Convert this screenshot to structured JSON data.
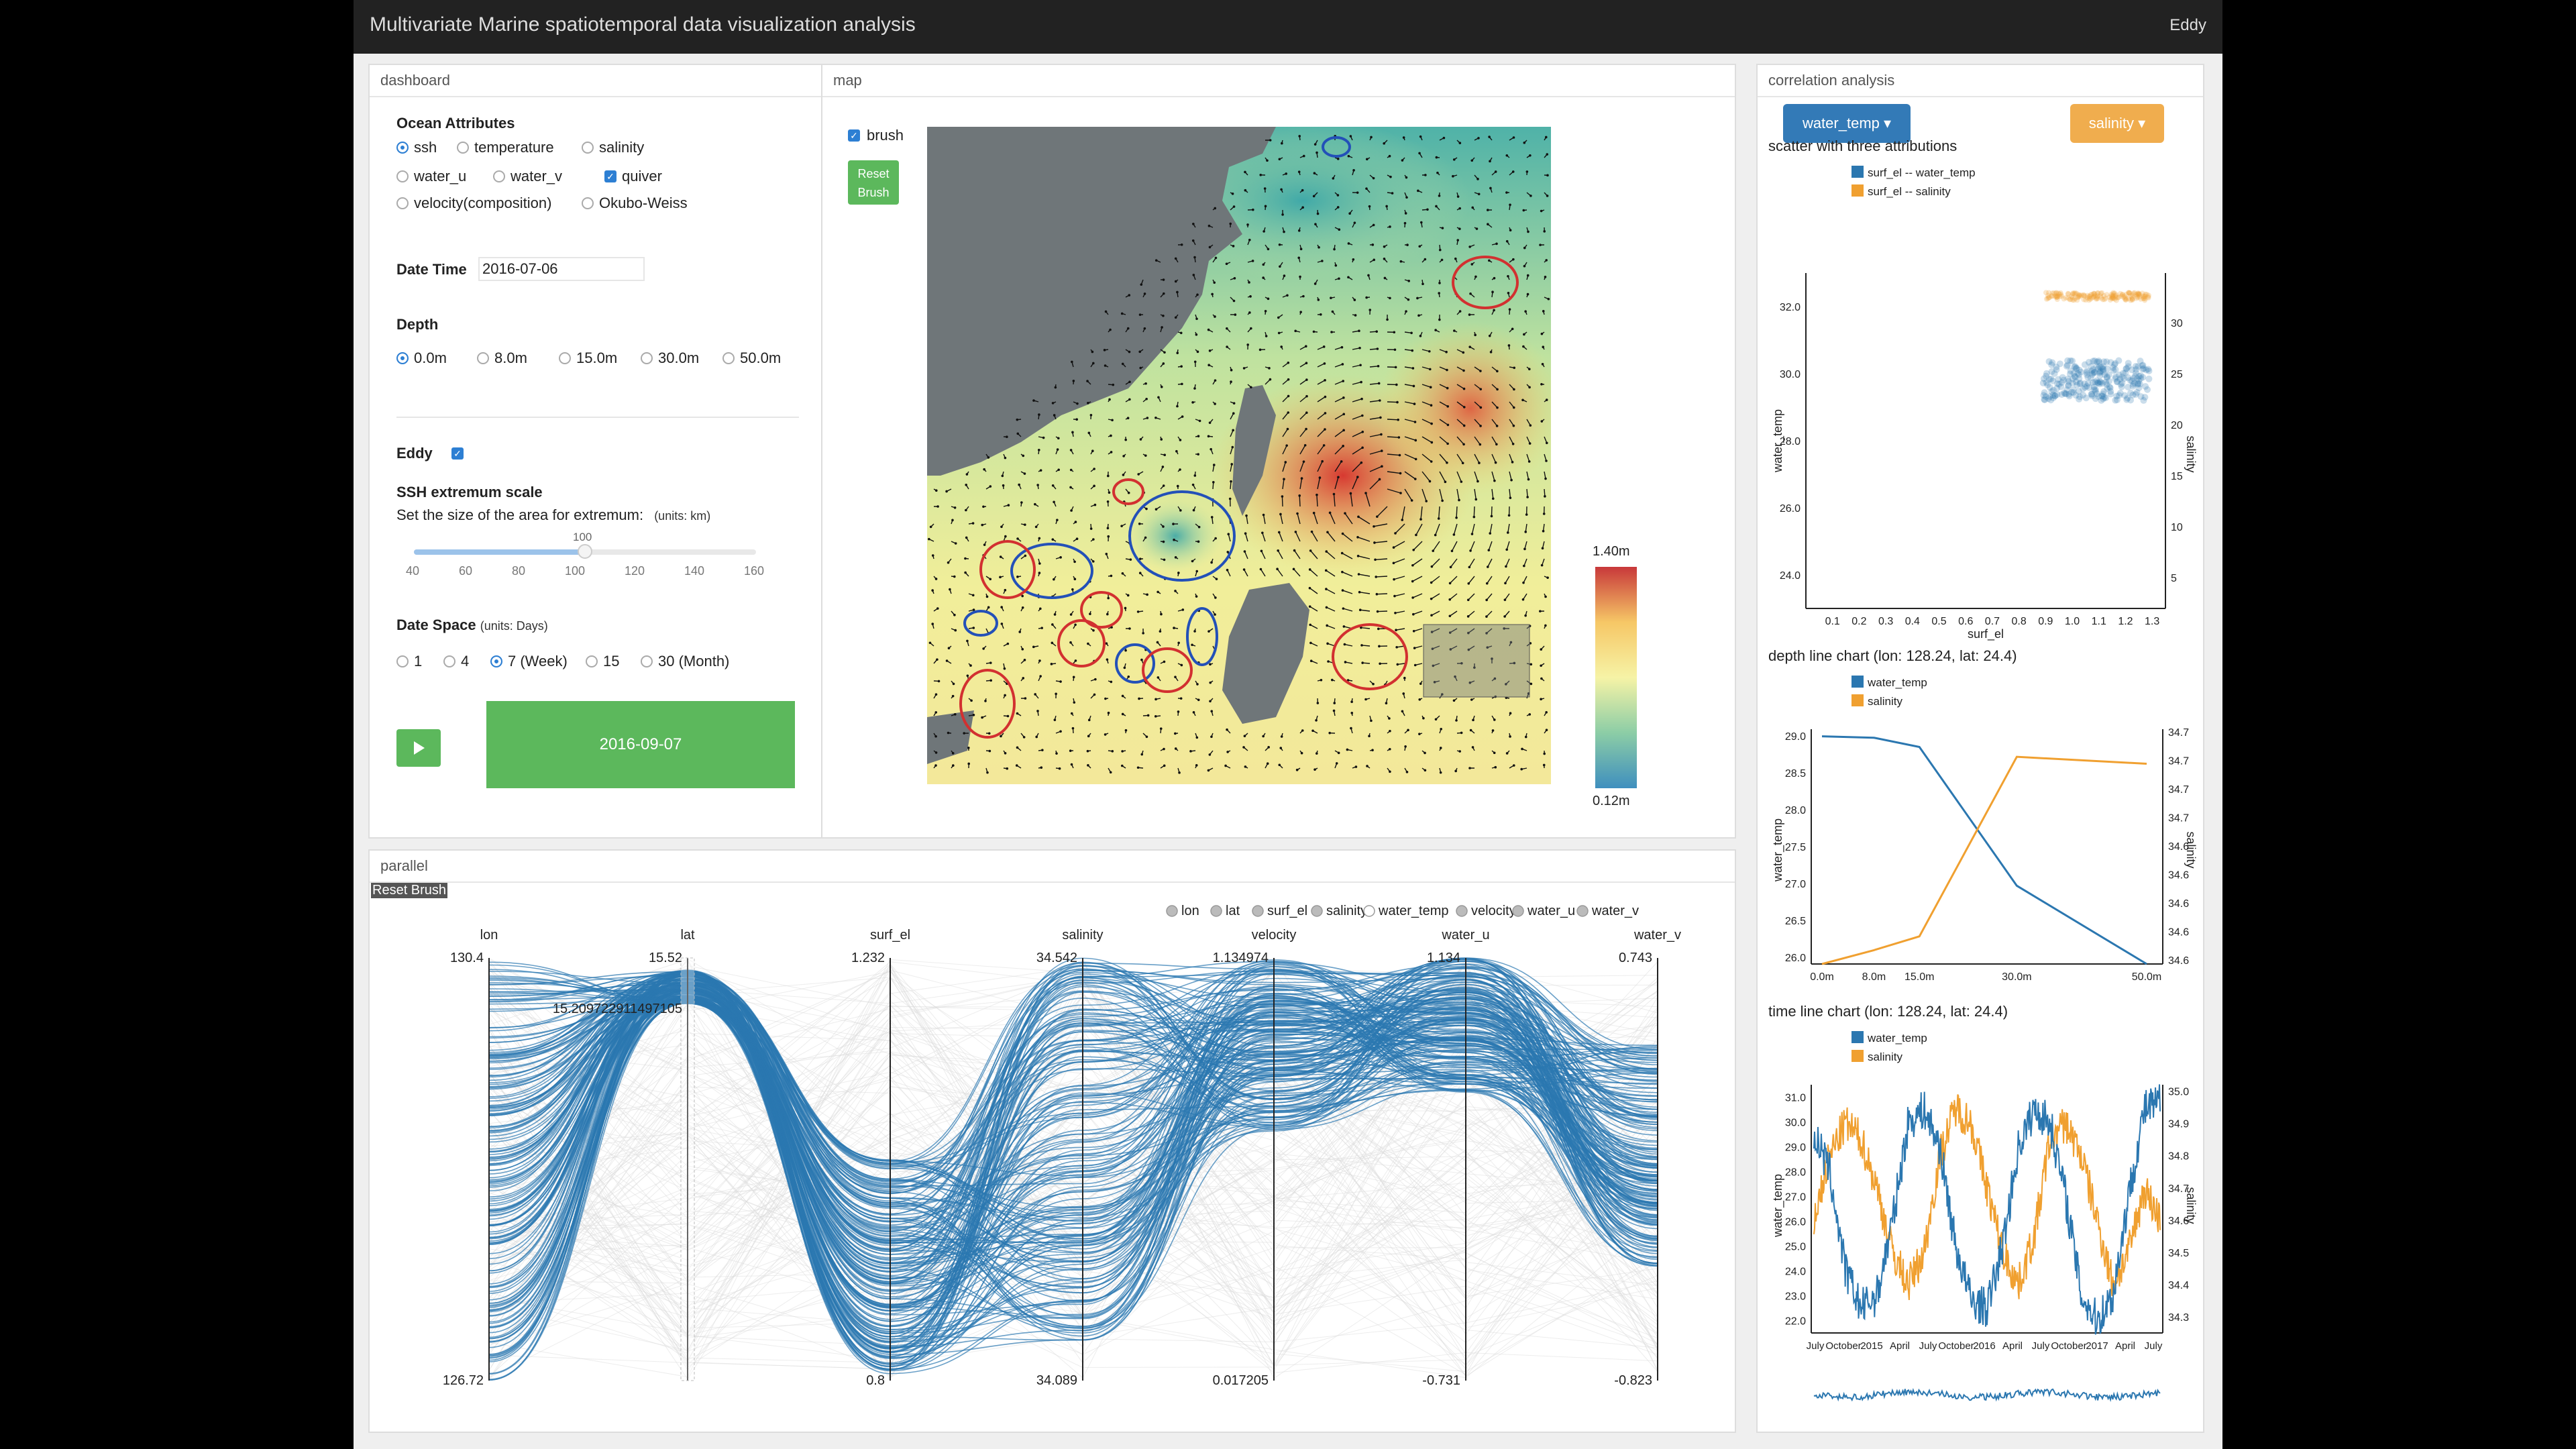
{
  "app": {
    "title": "Multivariate Marine spatiotemporal data visualization analysis",
    "user": "Eddy"
  },
  "dashboard": {
    "panel_title": "dashboard",
    "ocean_attributes": {
      "heading": "Ocean Attributes",
      "options": [
        "ssh",
        "temperature",
        "salinity",
        "water_u",
        "water_v",
        "quiver",
        "velocity(composition)",
        "Okubo-Weiss"
      ],
      "selected": "ssh",
      "quiver_checked": true
    },
    "date_time": {
      "label": "Date Time",
      "value": "2016-07-06"
    },
    "depth": {
      "heading": "Depth",
      "options": [
        "0.0m",
        "8.0m",
        "15.0m",
        "30.0m",
        "50.0m"
      ],
      "selected": "0.0m"
    },
    "eddy": {
      "label": "Eddy",
      "checked": true
    },
    "ssh_scale": {
      "heading": "SSH extremum scale",
      "description": "Set the size of the area for extremum:",
      "units": "(units: km)",
      "value": "100",
      "ticks": [
        "40",
        "60",
        "80",
        "100",
        "120",
        "140",
        "160"
      ],
      "value_fraction": 0.5
    },
    "date_space": {
      "heading": "Date Space",
      "units": "(units: Days)",
      "options": [
        "1",
        "4",
        "7 (Week)",
        "15",
        "30 (Month)"
      ],
      "selected": "7 (Week)"
    },
    "play_date": "2016-09-07"
  },
  "map": {
    "panel_title": "map",
    "brush_label": "brush",
    "brush_checked": true,
    "reset_brush_line1": "Reset",
    "reset_brush_line2": "Brush",
    "legend_max": "1.40m",
    "legend_min": "0.12m"
  },
  "parallel": {
    "panel_title": "parallel",
    "reset_label": "Reset Brush",
    "legend_items": [
      "lon",
      "lat",
      "surf_el",
      "salinity",
      "water_temp",
      "velocity",
      "water_u",
      "water_v"
    ],
    "legend_hollow": "water_temp",
    "axes": [
      {
        "name": "lon",
        "max": "130.4",
        "min": "126.72"
      },
      {
        "name": "lat",
        "max": "15.52",
        "min": ""
      },
      {
        "name": "surf_el",
        "max": "1.232",
        "min": "0.8"
      },
      {
        "name": "salinity",
        "max": "34.542",
        "min": "34.089"
      },
      {
        "name": "velocity",
        "max": "1.134974",
        "min": "0.017205"
      },
      {
        "name": "water_u",
        "max": "1.134",
        "min": "-0.731"
      },
      {
        "name": "water_v",
        "max": "0.743",
        "min": "-0.823"
      }
    ],
    "brush_value": "15.209722911497105"
  },
  "correlation": {
    "panel_title": "correlation analysis",
    "dropdown_left": "water_temp",
    "dropdown_right": "salinity",
    "colors": {
      "blue": "#2b77b0",
      "orange": "#f0a030"
    }
  },
  "chart_data": [
    {
      "type": "scatter",
      "title": "scatter with three attributions",
      "xlabel": "surf_el",
      "ylabel": "water_temp",
      "ylabel_right": "salinity",
      "x_ticks": [
        "0.1",
        "0.2",
        "0.3",
        "0.4",
        "0.5",
        "0.6",
        "0.7",
        "0.8",
        "0.9",
        "1.0",
        "1.1",
        "1.2",
        "1.3"
      ],
      "y_ticks": [
        "32.0",
        "30.0",
        "28.0",
        "26.0",
        "24.0"
      ],
      "y_right_ticks": [
        "30",
        "25",
        "20",
        "15",
        "10",
        "5"
      ],
      "xlim": [
        0,
        1.35
      ],
      "ylim": [
        23,
        33
      ],
      "series": [
        {
          "name": "surf_el -- water_temp",
          "x_range": [
            0.89,
            1.29
          ],
          "y_center": 29.8
        },
        {
          "name": "surf_el -- salinity",
          "x_range": [
            0.89,
            1.29
          ],
          "y_center": 32.3
        }
      ]
    },
    {
      "type": "line",
      "title": "depth line chart (lon: 128.24, lat: 24.4)",
      "categories": [
        "0.0m",
        "8.0m",
        "15.0m",
        "30.0m",
        "50.0m"
      ],
      "x": [
        0,
        8,
        15,
        30,
        50
      ],
      "ylabel": "water_temp",
      "ylabel_right": "salinity",
      "y_ticks": [
        "29.0",
        "28.5",
        "28.0",
        "27.5",
        "27.0",
        "26.5",
        "26.0"
      ],
      "y_right_ticks": [
        "34.7",
        "34.7",
        "34.7",
        "34.7",
        "34.6",
        "34.6",
        "34.6",
        "34.6",
        "34.6"
      ],
      "ylim": [
        25.9,
        29.2
      ],
      "ylim_right": [
        34.55,
        34.72
      ],
      "series": [
        {
          "name": "water_temp",
          "values": [
            29.1,
            29.08,
            28.95,
            27.0,
            25.9
          ]
        },
        {
          "name": "salinity",
          "values": [
            34.55,
            34.56,
            34.57,
            34.7,
            34.695
          ]
        }
      ]
    },
    {
      "type": "line",
      "title": "time line chart (lon: 128.24, lat: 24.4)",
      "ylabel": "water_temp",
      "ylabel_right": "salinity",
      "y_ticks": [
        "31.0",
        "30.0",
        "29.0",
        "28.0",
        "27.0",
        "26.0",
        "25.0",
        "24.0",
        "23.0",
        "22.0"
      ],
      "y_right_ticks": [
        "35.0",
        "34.9",
        "34.8",
        "34.7",
        "34.6",
        "34.5",
        "34.4",
        "34.3"
      ],
      "x_ticks": [
        "July",
        "October",
        "2015",
        "April",
        "July",
        "October",
        "2016",
        "April",
        "July",
        "October",
        "2017",
        "April",
        "July"
      ],
      "ylim": [
        21.5,
        31.5
      ],
      "ylim_right": [
        34.25,
        35.02
      ],
      "series": [
        {
          "name": "water_temp",
          "values": [
            29.5,
            28,
            24,
            22.5,
            23,
            26,
            30,
            30.5,
            29,
            25,
            22.8,
            22.5,
            25,
            29,
            30.5,
            30,
            27,
            23,
            22,
            23,
            27,
            30.5,
            30.8
          ]
        },
        {
          "name": "salinity",
          "values": [
            34.6,
            34.8,
            34.9,
            34.85,
            34.7,
            34.5,
            34.4,
            34.5,
            34.8,
            34.95,
            34.9,
            34.7,
            34.5,
            34.4,
            34.55,
            34.85,
            34.9,
            34.8,
            34.6,
            34.4,
            34.5,
            34.7,
            34.6
          ]
        }
      ]
    }
  ]
}
